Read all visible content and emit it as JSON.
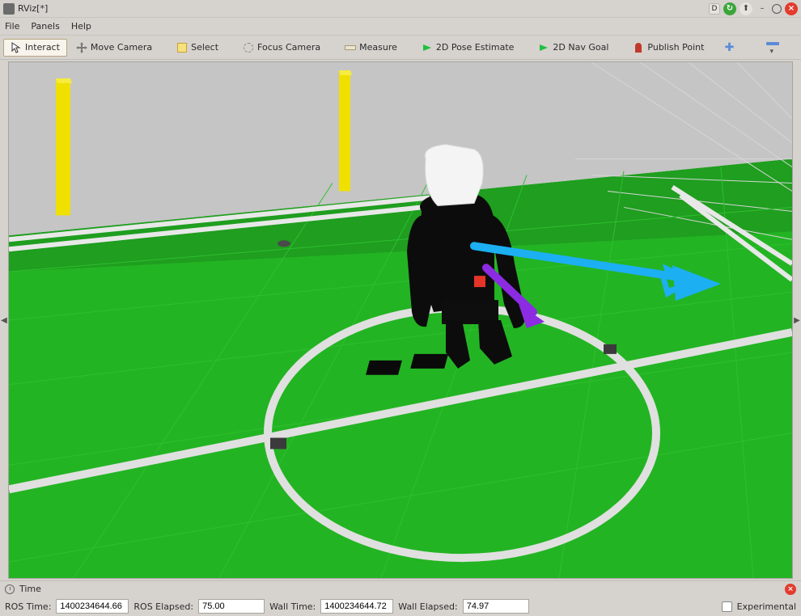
{
  "window": {
    "title": "RViz[*]"
  },
  "menubar": {
    "file": "File",
    "panels": "Panels",
    "help": "Help"
  },
  "toolbar": {
    "interact": "Interact",
    "move_camera": "Move Camera",
    "select": "Select",
    "focus_camera": "Focus Camera",
    "measure": "Measure",
    "pose_estimate": "2D Pose Estimate",
    "nav_goal": "2D Nav Goal",
    "publish_point": "Publish Point"
  },
  "time_panel": {
    "label": "Time"
  },
  "status": {
    "ros_time_label": "ROS Time:",
    "ros_time_value": "1400234644.66",
    "ros_elapsed_label": "ROS Elapsed:",
    "ros_elapsed_value": "75.00",
    "wall_time_label": "Wall Time:",
    "wall_time_value": "1400234644.72",
    "wall_elapsed_label": "Wall Elapsed:",
    "wall_elapsed_value": "74.97",
    "experimental_label": "Experimental"
  }
}
